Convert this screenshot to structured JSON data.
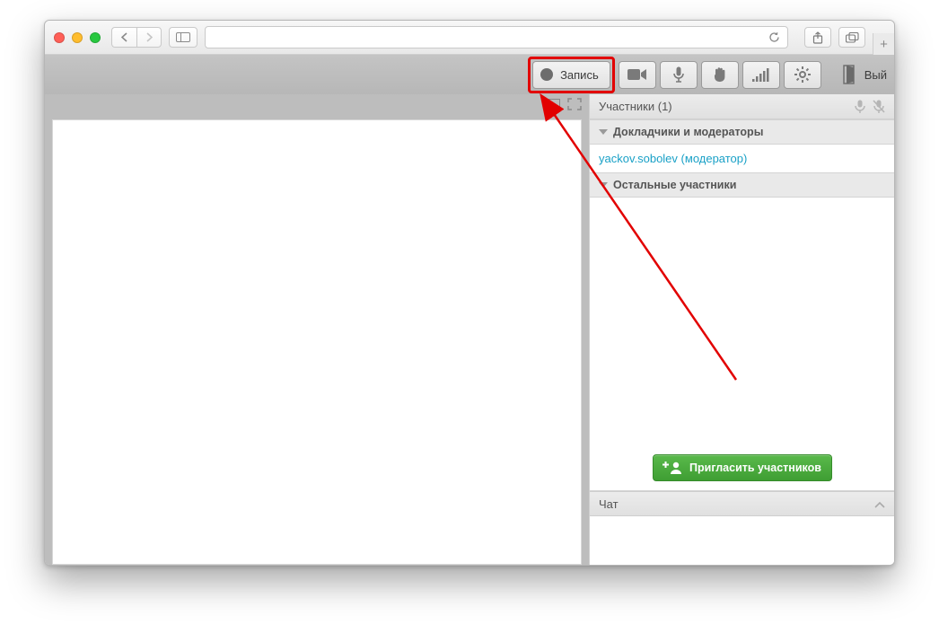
{
  "toolbar": {
    "record_label": "Запись",
    "exit_label": "Вый"
  },
  "participants": {
    "header_prefix": "Участники",
    "count": "(1)",
    "group_speakers": "Докладчики и модераторы",
    "group_others": "Остальные участники",
    "member_name": "yackov.sobolev",
    "member_role": "(модератор)",
    "invite_label": "Пригласить участников"
  },
  "chat": {
    "label": "Чат"
  },
  "colors": {
    "highlight": "#e20000",
    "accent_green": "#45a838",
    "link": "#1aa1c7"
  }
}
